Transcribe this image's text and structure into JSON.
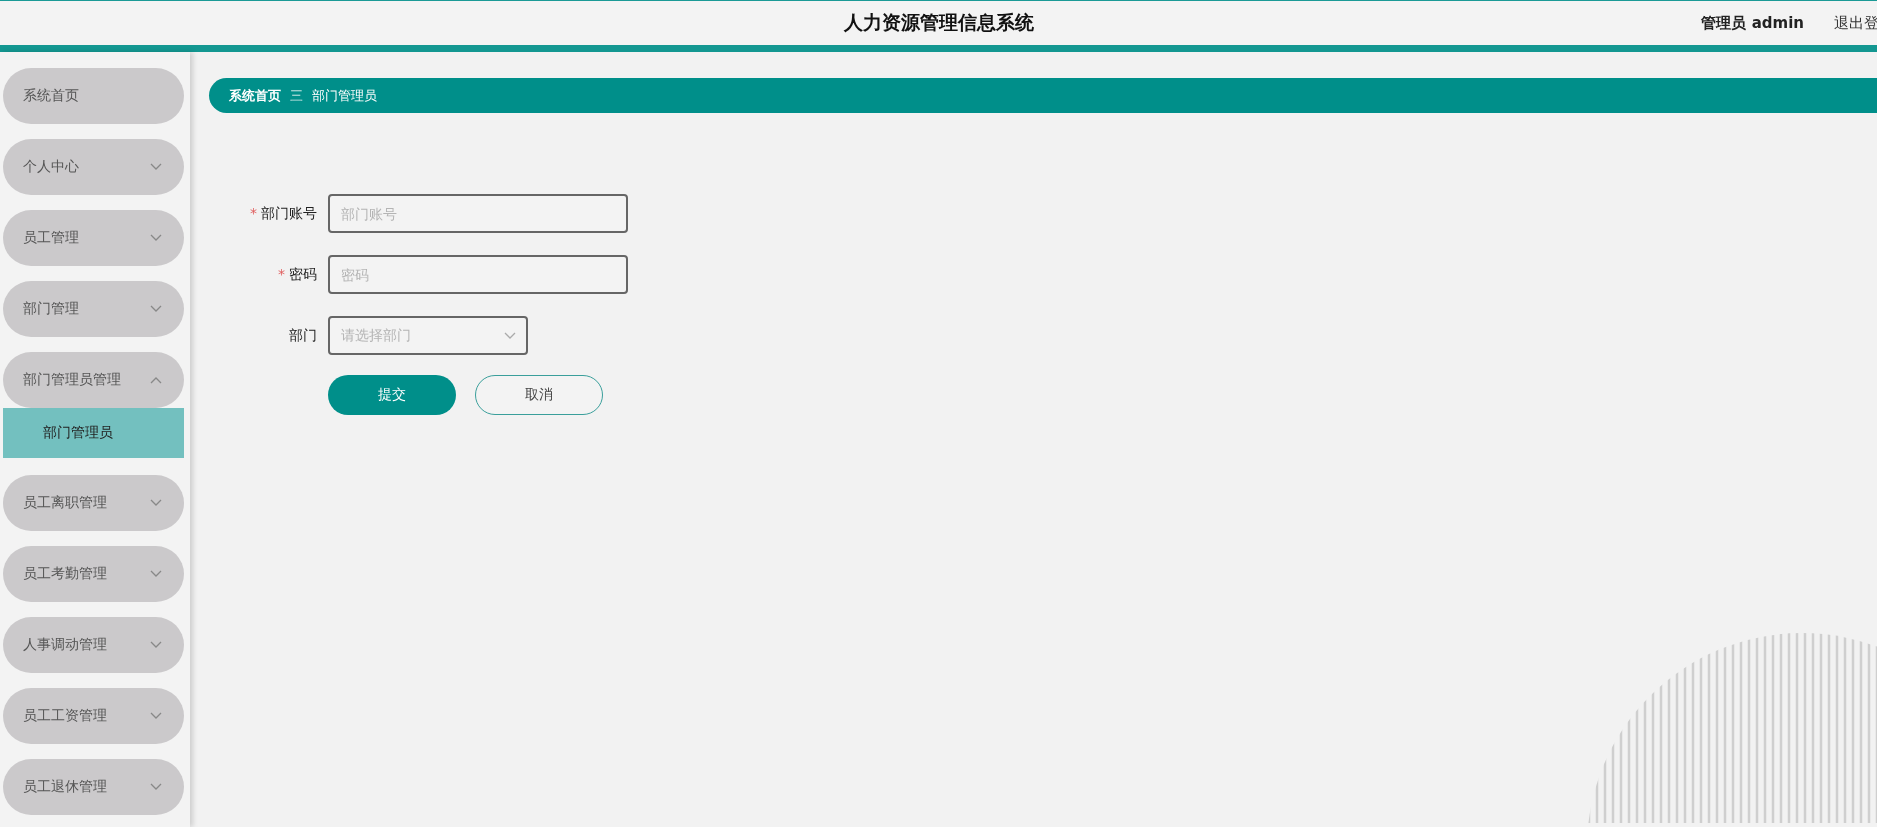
{
  "header": {
    "title": "人力资源管理信息系统",
    "user": "管理员 admin",
    "logout": "退出登"
  },
  "sidebar": {
    "items": [
      {
        "label": "系统首页",
        "kind": "link"
      },
      {
        "label": "个人中心",
        "kind": "menu",
        "expanded": false
      },
      {
        "label": "员工管理",
        "kind": "menu",
        "expanded": false
      },
      {
        "label": "部门管理",
        "kind": "menu",
        "expanded": false
      },
      {
        "label": "部门管理员管理",
        "kind": "menu",
        "expanded": true,
        "children": [
          {
            "label": "部门管理员",
            "selected": true
          }
        ]
      },
      {
        "label": "员工离职管理",
        "kind": "menu",
        "expanded": false
      },
      {
        "label": "员工考勤管理",
        "kind": "menu",
        "expanded": false
      },
      {
        "label": "人事调动管理",
        "kind": "menu",
        "expanded": false
      },
      {
        "label": "员工工资管理",
        "kind": "menu",
        "expanded": false
      },
      {
        "label": "员工退休管理",
        "kind": "menu",
        "expanded": false
      }
    ]
  },
  "breadcrumb": {
    "items": [
      "系统首页",
      "部门管理员"
    ],
    "separator": "三"
  },
  "form": {
    "fields": [
      {
        "label": "部门账号",
        "mark": "*",
        "kind": "text",
        "placeholder": "部门账号"
      },
      {
        "label": "密码",
        "mark": "*",
        "kind": "text",
        "placeholder": "密码"
      },
      {
        "label": "部门",
        "kind": "select",
        "placeholder": "请选择部门"
      }
    ],
    "buttons": [
      {
        "label": "提交",
        "kind": "primary"
      },
      {
        "label": "取消",
        "kind": "secondary"
      }
    ]
  }
}
